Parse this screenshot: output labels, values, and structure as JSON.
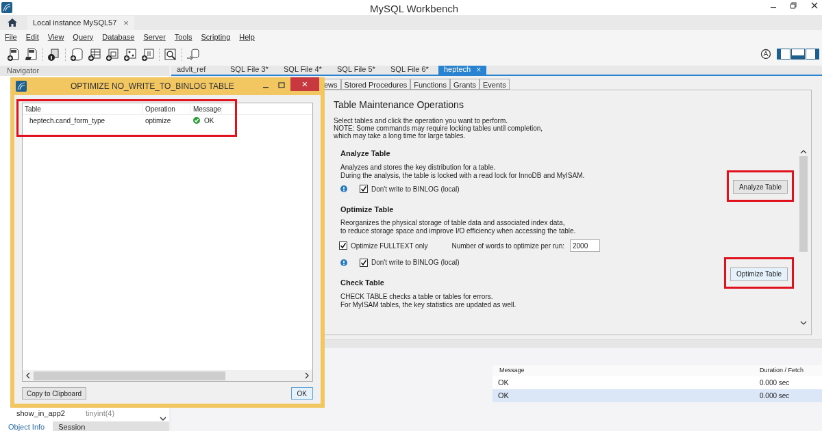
{
  "window": {
    "title": "MySQL Workbench"
  },
  "connection_tab": {
    "label": "Local instance MySQL57",
    "close": "×"
  },
  "menu": [
    "File",
    "Edit",
    "View",
    "Query",
    "Database",
    "Server",
    "Tools",
    "Scripting",
    "Help"
  ],
  "navigator": {
    "title": "Navigator",
    "column_row": {
      "name": "show_in_app2",
      "type": "tinyint(4)"
    },
    "tabs": [
      {
        "label": "Object Info",
        "selected": true
      },
      {
        "label": "Session",
        "selected": false
      }
    ]
  },
  "editor_tabs": [
    {
      "label": "advlt_ref",
      "selected": false
    },
    {
      "label": "SQL File 3*",
      "selected": false
    },
    {
      "label": "SQL File 4*",
      "selected": false
    },
    {
      "label": "SQL File 5*",
      "selected": false
    },
    {
      "label": "SQL File 6*",
      "selected": false
    },
    {
      "label": "heptech",
      "selected": true,
      "close": "×"
    }
  ],
  "sub_tabs": [
    {
      "label": "ews",
      "selected": false
    },
    {
      "label": "Stored Procedures",
      "selected": false
    },
    {
      "label": "Functions",
      "selected": false
    },
    {
      "label": "Grants",
      "selected": false
    },
    {
      "label": "Events",
      "selected": false
    }
  ],
  "maintenance": {
    "title": "Table Maintenance Operations",
    "intro": [
      "Select tables and click the operation you want to perform.",
      "NOTE: Some commands may require locking tables until completion,",
      "which may take a long time for large tables."
    ],
    "sections": [
      {
        "kind": "analyze",
        "title": "Analyze Table",
        "description": [
          "Analyzes and stores the key distribution for a table.",
          "During the analysis, the table is locked with a read lock for InnoDB and MyISAM."
        ],
        "options": [
          {
            "label": "Don't write to BINLOG (local)",
            "checked": true,
            "info": true
          }
        ],
        "button": {
          "label": "Analyze Table",
          "highlighted": true
        }
      },
      {
        "kind": "optimize",
        "title": "Optimize Table",
        "description": [
          "Reorganizes the physical storage of table data and associated index data,",
          "to reduce storage space and improve I/O efficiency when accessing the table."
        ],
        "options": [
          {
            "label": "Optimize FULLTEXT only",
            "checked": true,
            "info": false
          },
          {
            "label": "Don't write to BINLOG (local)",
            "checked": true,
            "info": true
          }
        ],
        "words": {
          "label": "Number of words to optimize per run:",
          "value": "2000"
        },
        "button": {
          "label": "Optimize Table",
          "highlighted": true
        }
      },
      {
        "kind": "check",
        "title": "Check Table",
        "description": [
          "CHECK TABLE checks a table or tables for errors.",
          "For MyISAM tables, the key statistics are updated as well."
        ]
      }
    ]
  },
  "output": {
    "columns": [
      "Message",
      "Duration / Fetch"
    ],
    "rows": [
      {
        "message": "OK",
        "duration": "0.000 sec",
        "selected": false
      },
      {
        "message": "OK",
        "duration": "0.000 sec",
        "selected": true
      }
    ]
  },
  "dialog": {
    "title": "OPTIMIZE NO_WRITE_TO_BINLOG TABLE",
    "close": "×",
    "highlighted": true,
    "columns": [
      "Table",
      "Operation",
      "Message"
    ],
    "rows": [
      {
        "table": "heptech.cand_form_type",
        "operation": "optimize",
        "message": "OK"
      }
    ],
    "buttons": [
      "Copy to Clipboard",
      "OK"
    ]
  }
}
